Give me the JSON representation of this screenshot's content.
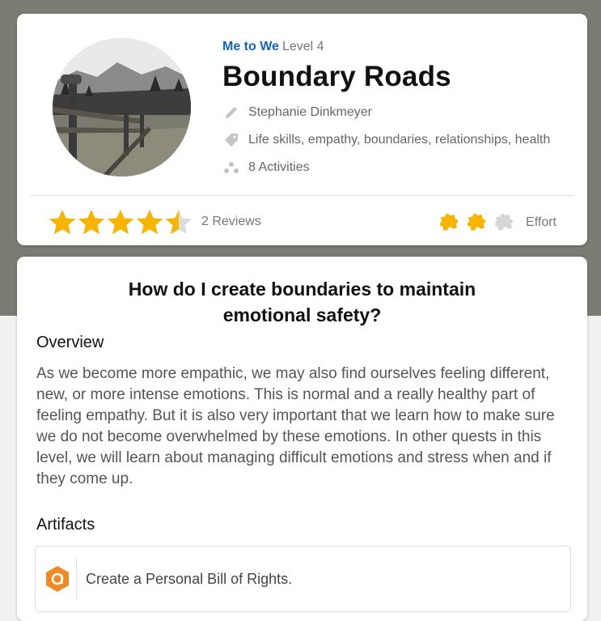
{
  "header": {
    "group": "Me to We",
    "level": "Level 4",
    "title": "Boundary Roads",
    "author": "Stephanie Dinkmeyer",
    "tags": "Life skills, empathy, boundaries, relationships, health",
    "activities": "8 Activities",
    "icons": {
      "author": "pencil-icon",
      "tags": "tag-icon",
      "activities": "activities-icon"
    }
  },
  "rating": {
    "stars": 4.5,
    "max_stars": 5,
    "reviews": "2 Reviews",
    "star_color": "#f7b500"
  },
  "effort": {
    "level": 2,
    "max": 3,
    "label": "Effort",
    "active_color": "#f7b500",
    "inactive_color": "#d6d6d6"
  },
  "body": {
    "question": "How do I create boundaries to maintain emotional safety?",
    "overview_heading": "Overview",
    "overview_text": "As we become more empathic, we may also find ourselves feeling different, new, or more intense emotions. This is normal and a really healthy part of feeling empathy. But it is also very important that we learn how to make sure we do not become overwhelmed by these emotions. In other quests in this level, we will learn about managing difficult emotions and stress when and if they come up.",
    "artifacts_heading": "Artifacts",
    "artifacts": [
      {
        "label": "Create a Personal Bill of Rights.",
        "icon": "artifact-badge-icon",
        "icon_color": "#f08a24"
      }
    ]
  },
  "colors": {
    "accent": "#1565c0",
    "background_top": "#7b7b73"
  }
}
